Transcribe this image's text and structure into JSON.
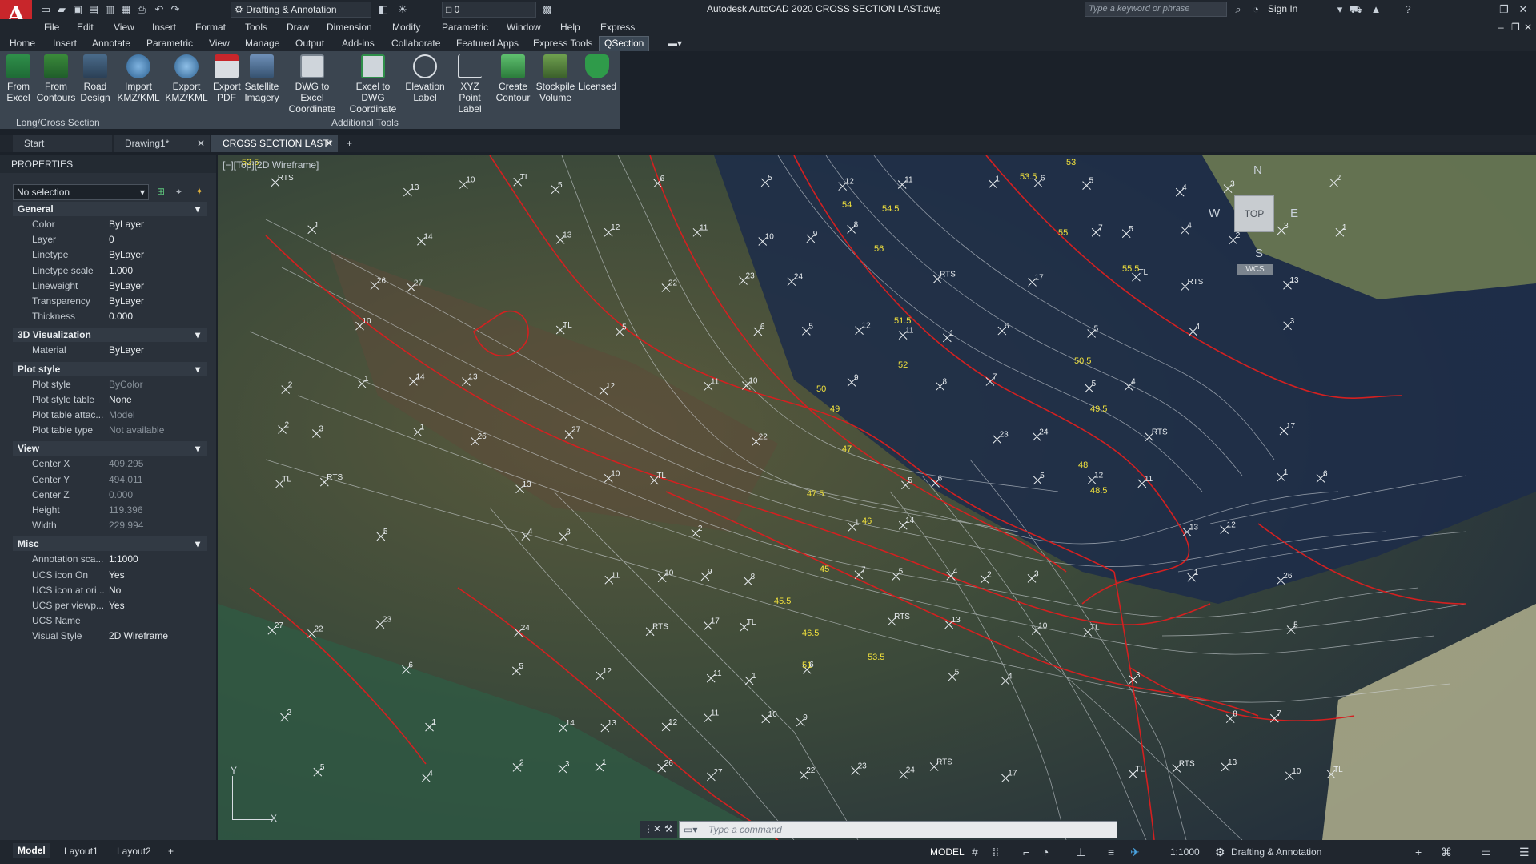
{
  "app": {
    "logo_text": "A",
    "title": "Autodesk AutoCAD 2020    CROSS SECTION LAST.dwg",
    "workspace": "Drafting & Annotation",
    "layer_combo": "0",
    "search_placeholder": "Type a keyword or phrase",
    "sign_in": "Sign In"
  },
  "menubar": [
    "File",
    "Edit",
    "View",
    "Insert",
    "Format",
    "Tools",
    "Draw",
    "Dimension",
    "Modify",
    "Parametric",
    "Window",
    "Help",
    "Express"
  ],
  "ribbon_tabs": [
    "Home",
    "Insert",
    "Annotate",
    "Parametric",
    "View",
    "Manage",
    "Output",
    "Add-ins",
    "Collaborate",
    "Featured Apps",
    "Express Tools",
    "QSection"
  ],
  "ribbon_active_tab": "QSection",
  "ribbon": {
    "buttons": [
      {
        "line1": "From",
        "line2": "Excel",
        "icon": "spreadsheet-icon"
      },
      {
        "line1": "From",
        "line2": "Contours",
        "icon": "contours-icon"
      },
      {
        "line1": "Road",
        "line2": "Design",
        "icon": "road-icon"
      },
      {
        "line1": "Import",
        "line2": "KMZ/KML",
        "icon": "globe-icon"
      },
      {
        "line1": "Export",
        "line2": "KMZ/KML",
        "icon": "globe-export-icon"
      },
      {
        "line1": "Export",
        "line2": "PDF",
        "icon": "pdf-icon"
      },
      {
        "line1": "Satellite",
        "line2": "Imagery",
        "icon": "satellite-icon"
      },
      {
        "line1": "DWG to Excel",
        "line2": "Coordinate",
        "icon": "dwg-excel-icon"
      },
      {
        "line1": "Excel to DWG",
        "line2": "Coordinate",
        "icon": "excel-dwg-icon"
      },
      {
        "line1": "Elevation",
        "line2": "Label",
        "icon": "elevation-icon"
      },
      {
        "line1": "XYZ Point",
        "line2": "Label",
        "icon": "xyz-icon"
      },
      {
        "line1": "Create",
        "line2": "Contour",
        "icon": "contour-create-icon"
      },
      {
        "line1": "Stockpile",
        "line2": "Volume",
        "icon": "stockpile-icon"
      },
      {
        "line1": "Licensed",
        "line2": "",
        "icon": "shield-icon"
      }
    ],
    "panel_labels": [
      "Long/Cross Section",
      "Additional Tools"
    ]
  },
  "file_tabs": [
    "Start",
    "Drawing1*",
    "CROSS SECTION LAST*"
  ],
  "properties": {
    "title": "PROPERTIES",
    "selection": "No selection",
    "sections": [
      {
        "name": "General",
        "rows": [
          [
            "Color",
            "ByLayer"
          ],
          [
            "Layer",
            "0"
          ],
          [
            "Linetype",
            "ByLayer"
          ],
          [
            "Linetype scale",
            "1.000"
          ],
          [
            "Lineweight",
            "ByLayer"
          ],
          [
            "Transparency",
            "ByLayer"
          ],
          [
            "Thickness",
            "0.000"
          ]
        ]
      },
      {
        "name": "3D Visualization",
        "rows": [
          [
            "Material",
            "ByLayer"
          ]
        ]
      },
      {
        "name": "Plot style",
        "rows": [
          [
            "Plot style",
            "ByColor"
          ],
          [
            "Plot style table",
            "None"
          ],
          [
            "Plot table attac...",
            "Model"
          ],
          [
            "Plot table type",
            "Not available"
          ]
        ]
      },
      {
        "name": "View",
        "rows": [
          [
            "Center X",
            "409.295"
          ],
          [
            "Center Y",
            "494.011"
          ],
          [
            "Center Z",
            "0.000"
          ],
          [
            "Height",
            "119.396"
          ],
          [
            "Width",
            "229.994"
          ]
        ]
      },
      {
        "name": "Misc",
        "rows": [
          [
            "Annotation sca...",
            "1:1000"
          ],
          [
            "UCS icon On",
            "Yes"
          ],
          [
            "UCS icon at ori...",
            "No"
          ],
          [
            "UCS per viewp...",
            "Yes"
          ],
          [
            "UCS Name",
            ""
          ],
          [
            "Visual Style",
            "2D Wireframe"
          ]
        ]
      }
    ]
  },
  "viewport": {
    "label": "[−][Top][2D Wireframe]",
    "viewcube": {
      "top": "TOP",
      "n": "N",
      "s": "S",
      "e": "E",
      "w": "W",
      "wcs": "WCS"
    },
    "contour_labels": [
      "52.5",
      "53",
      "53.5",
      "54",
      "54.5",
      "55",
      "55.5",
      "56",
      "51.5",
      "52",
      "50.5",
      "50",
      "49",
      "49.5",
      "48",
      "48.5",
      "47",
      "47.5",
      "46",
      "45.5",
      "46.5",
      "45",
      "51",
      "53.5"
    ],
    "point_labels": [
      "RTS",
      "13",
      "10",
      "TL",
      "5",
      "6",
      "5",
      "12",
      "11",
      "1",
      "6",
      "5",
      "4",
      "3",
      "2",
      "1",
      "14",
      "13",
      "12",
      "11",
      "10",
      "9",
      "8",
      "7",
      "5",
      "4",
      "2",
      "3",
      "1",
      "26",
      "27",
      "22",
      "23",
      "24",
      "RTS",
      "17",
      "TL"
    ]
  },
  "command": {
    "placeholder": "Type  a  command"
  },
  "status": {
    "layout_tabs": [
      "Model",
      "Layout1",
      "Layout2"
    ],
    "model": "MODEL",
    "scale": "1:1000",
    "workspace": "Drafting & Annotation"
  },
  "colors": {
    "contour_major": "#d42020",
    "contour_minor": "#d8dde2",
    "label_yellow": "#f2e23c",
    "accent_red": "#c8262b"
  }
}
